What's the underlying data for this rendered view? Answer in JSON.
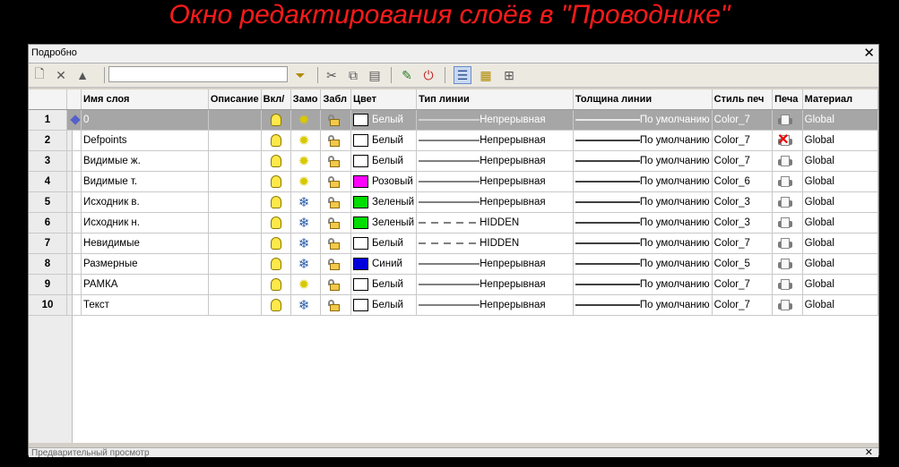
{
  "caption": "Окно редактирования слоёв в \"Проводнике\"",
  "window": {
    "title": "Подробно",
    "bottom_panel": "Предварительный просмотр"
  },
  "toolbar": {
    "icons": [
      "new-layer-icon",
      "delete-icon",
      "set-current-icon",
      "filter-icon",
      "cut-icon",
      "copy-icon",
      "paste-icon",
      "edit-icon",
      "purge-icon",
      "details-view-icon",
      "large-icons-view-icon",
      "tree-view-icon"
    ],
    "filter_value": ""
  },
  "columns": [
    "",
    "",
    "Имя слоя",
    "Описание",
    "Вкл/",
    "Замо",
    "Забл",
    "Цвет",
    "Тип линии",
    "Толщина линии",
    "Стиль печ",
    "Печа",
    "Материал"
  ],
  "rows": [
    {
      "num": "1",
      "name": "0",
      "on": true,
      "frozen": false,
      "color_hex": "#ffffff",
      "color": "Белый",
      "linetype": "Непрерывная",
      "dashed": false,
      "lineweight": "По умолчанию",
      "plotstyle": "Color_7",
      "plot": true,
      "material": "Global",
      "selected": true
    },
    {
      "num": "2",
      "name": "Defpoints",
      "on": true,
      "frozen": false,
      "color_hex": "#ffffff",
      "color": "Белый",
      "linetype": "Непрерывная",
      "dashed": false,
      "lineweight": "По умолчанию",
      "plotstyle": "Color_7",
      "plot": false,
      "material": "Global",
      "selected": false
    },
    {
      "num": "3",
      "name": "Видимые ж.",
      "on": true,
      "frozen": false,
      "color_hex": "#ffffff",
      "color": "Белый",
      "linetype": "Непрерывная",
      "dashed": false,
      "lineweight": "По умолчанию",
      "plotstyle": "Color_7",
      "plot": true,
      "material": "Global",
      "selected": false
    },
    {
      "num": "4",
      "name": "Видимые т.",
      "on": true,
      "frozen": false,
      "color_hex": "#ff00ff",
      "color": "Розовый",
      "linetype": "Непрерывная",
      "dashed": false,
      "lineweight": "По умолчанию",
      "plotstyle": "Color_6",
      "plot": true,
      "material": "Global",
      "selected": false
    },
    {
      "num": "5",
      "name": "Исходник в.",
      "on": true,
      "frozen": true,
      "color_hex": "#00dd00",
      "color": "Зеленый",
      "linetype": "Непрерывная",
      "dashed": false,
      "lineweight": "По умолчанию",
      "plotstyle": "Color_3",
      "plot": true,
      "material": "Global",
      "selected": false
    },
    {
      "num": "6",
      "name": "Исходник н.",
      "on": true,
      "frozen": true,
      "color_hex": "#00dd00",
      "color": "Зеленый",
      "linetype": "HIDDEN",
      "dashed": true,
      "lineweight": "По умолчанию",
      "plotstyle": "Color_3",
      "plot": true,
      "material": "Global",
      "selected": false
    },
    {
      "num": "7",
      "name": "Невидимые",
      "on": true,
      "frozen": true,
      "color_hex": "#ffffff",
      "color": "Белый",
      "linetype": "HIDDEN",
      "dashed": true,
      "lineweight": "По умолчанию",
      "plotstyle": "Color_7",
      "plot": true,
      "material": "Global",
      "selected": false
    },
    {
      "num": "8",
      "name": "Размерные",
      "on": true,
      "frozen": true,
      "color_hex": "#0000dd",
      "color": "Синий",
      "linetype": "Непрерывная",
      "dashed": false,
      "lineweight": "По умолчанию",
      "plotstyle": "Color_5",
      "plot": true,
      "material": "Global",
      "selected": false
    },
    {
      "num": "9",
      "name": "РАМКА",
      "on": true,
      "frozen": false,
      "color_hex": "#ffffff",
      "color": "Белый",
      "linetype": "Непрерывная",
      "dashed": false,
      "lineweight": "По умолчанию",
      "plotstyle": "Color_7",
      "plot": true,
      "material": "Global",
      "selected": false
    },
    {
      "num": "10",
      "name": "Текст",
      "on": true,
      "frozen": true,
      "color_hex": "#ffffff",
      "color": "Белый",
      "linetype": "Непрерывная",
      "dashed": false,
      "lineweight": "По умолчанию",
      "plotstyle": "Color_7",
      "plot": true,
      "material": "Global",
      "selected": false
    }
  ]
}
